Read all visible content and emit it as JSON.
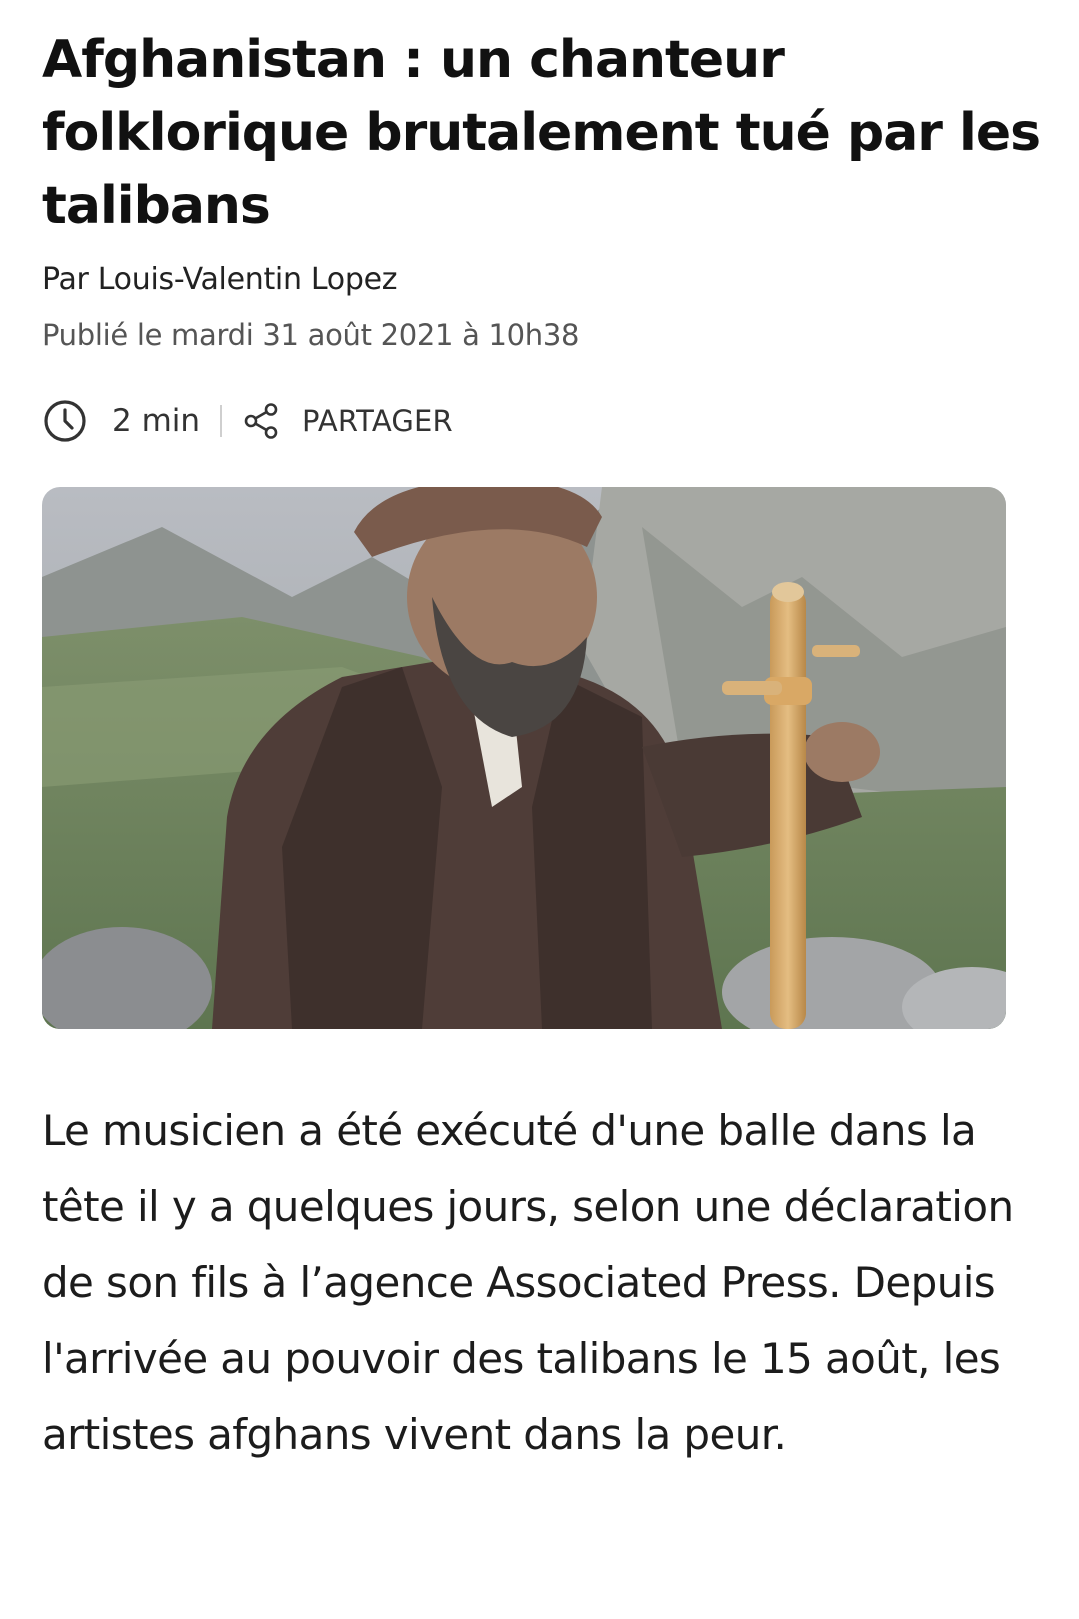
{
  "article": {
    "headline": "Afghanistan : un chanteur folklorique brutalement tué par les talibans",
    "byline": "Par Louis-Valentin Lopez",
    "published": "Publié le mardi 31 août 2021 à 10h38",
    "read_time": "2 min",
    "share_label": "PARTAGER",
    "lead": "Le musicien a été exécuté d'une balle dans la tête il y a quelques jours, selon une déclaration de son fils à l’agence Associated Press. Depuis l'arrivée au pouvoir des talibans le 15 août, les artistes afghans vivent dans la peur."
  },
  "icons": {
    "clock": "clock-icon",
    "share": "share-icon"
  },
  "colors": {
    "text": "#111111",
    "muted": "#555555",
    "divider": "#cfcfcf"
  }
}
